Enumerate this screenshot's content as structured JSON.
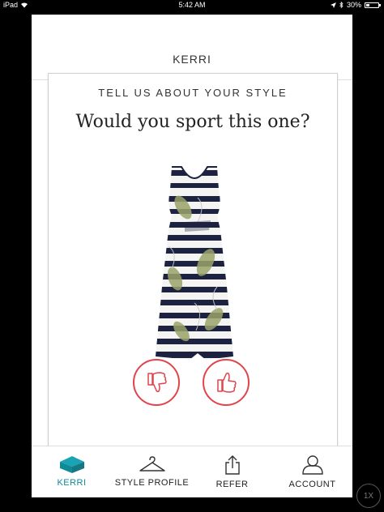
{
  "status_bar": {
    "device": "iPad",
    "time": "5:42 AM",
    "battery": "30%",
    "battery_level": 0.3
  },
  "header": {
    "title": "KERRI"
  },
  "card": {
    "kicker": "TELL US ABOUT YOUR STYLE",
    "question": "Would you sport this one?",
    "item_image": "striped-palm-print-maxi-dress"
  },
  "actions": {
    "thumbs_down_icon": "thumbs-down-icon",
    "thumbs_up_icon": "thumbs-up-icon",
    "accent_color": "#e0444c"
  },
  "tabbar": {
    "active_color": "#0e8a99",
    "tabs": [
      {
        "label": "KERRI",
        "icon": "box-icon",
        "active": true
      },
      {
        "label": "STYLE PROFILE",
        "icon": "hanger-icon",
        "active": false
      },
      {
        "label": "REFER",
        "icon": "share-icon",
        "active": false
      },
      {
        "label": "ACCOUNT",
        "icon": "person-icon",
        "active": false
      }
    ]
  },
  "overlay": {
    "speed_label": "1X"
  }
}
